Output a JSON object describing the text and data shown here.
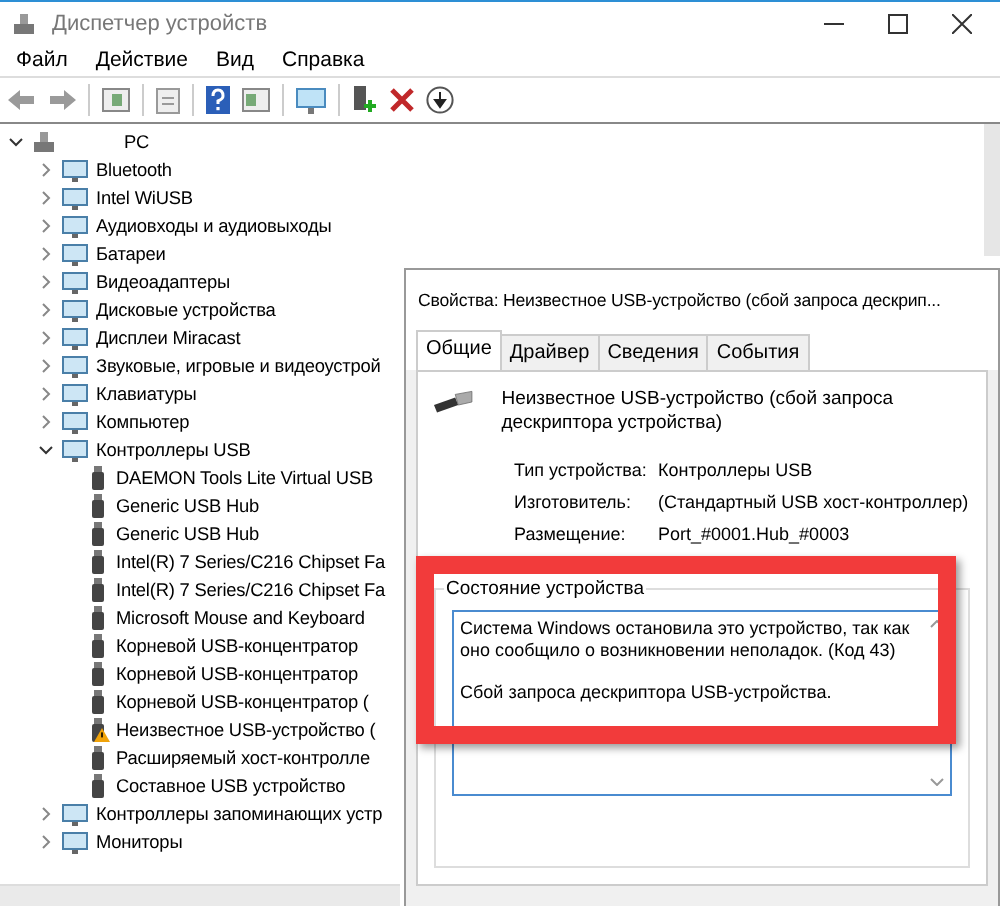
{
  "window": {
    "title": "Диспетчер устройств"
  },
  "menu": [
    "Файл",
    "Действие",
    "Вид",
    "Справка"
  ],
  "tree": {
    "label": "PC",
    "expanded": true,
    "children": [
      {
        "label": "Bluetooth",
        "expanded": false
      },
      {
        "label": "Intel WiUSB",
        "expanded": false
      },
      {
        "label": "Аудиовходы и аудиовыходы",
        "expanded": false
      },
      {
        "label": "Батареи",
        "expanded": false
      },
      {
        "label": "Видеоадаптеры",
        "expanded": false
      },
      {
        "label": "Дисковые устройства",
        "expanded": false
      },
      {
        "label": "Дисплеи Miracast",
        "expanded": false
      },
      {
        "label": "Звуковые, игровые и видеоустрой",
        "expanded": false
      },
      {
        "label": "Клавиатуры",
        "expanded": false
      },
      {
        "label": "Компьютер",
        "expanded": false
      },
      {
        "label": "Контроллеры USB",
        "expanded": true,
        "children": [
          {
            "label": "DAEMON Tools Lite Virtual USB",
            "warning": false
          },
          {
            "label": "Generic USB Hub",
            "warning": false
          },
          {
            "label": "Generic USB Hub",
            "warning": false
          },
          {
            "label": "Intel(R) 7 Series/C216 Chipset Fa",
            "warning": false
          },
          {
            "label": "Intel(R) 7 Series/C216 Chipset Fa",
            "warning": false
          },
          {
            "label": "Microsoft Mouse and Keyboard",
            "warning": false
          },
          {
            "label": "Корневой USB-концентратор",
            "warning": false
          },
          {
            "label": "Корневой USB-концентратор",
            "warning": false
          },
          {
            "label": "Корневой USB-концентратор (",
            "warning": false
          },
          {
            "label": "Неизвестное USB-устройство (",
            "warning": true
          },
          {
            "label": "Расширяемый хост-контролле",
            "warning": false
          },
          {
            "label": "Составное USB устройство",
            "warning": false
          }
        ]
      },
      {
        "label": "Контроллеры запоминающих устр",
        "expanded": false
      },
      {
        "label": "Мониторы",
        "expanded": false
      }
    ]
  },
  "dialog": {
    "title": "Свойства: Неизвестное USB-устройство (сбой запроса дескрип...",
    "tabs": [
      {
        "label": "Общие",
        "selected": true
      },
      {
        "label": "Драйвер",
        "selected": false
      },
      {
        "label": "Сведения",
        "selected": false
      },
      {
        "label": "События",
        "selected": false
      }
    ],
    "device_name": "Неизвестное USB-устройство (сбой запроса дескриптора устройства)",
    "properties": [
      {
        "label": "Тип устройства:",
        "value": "Контроллеры USB"
      },
      {
        "label": "Изготовитель:",
        "value": "(Стандартный USB хост-контроллер)"
      },
      {
        "label": "Размещение:",
        "value": "Port_#0001.Hub_#0003"
      }
    ],
    "status": {
      "label": "Состояние устройства",
      "paragraphs": [
        "Система Windows остановила это устройство, так как оно сообщило о возникновении неполадок. (Код 43)",
        "Сбой запроса дескриптора USB-устройства."
      ]
    }
  }
}
